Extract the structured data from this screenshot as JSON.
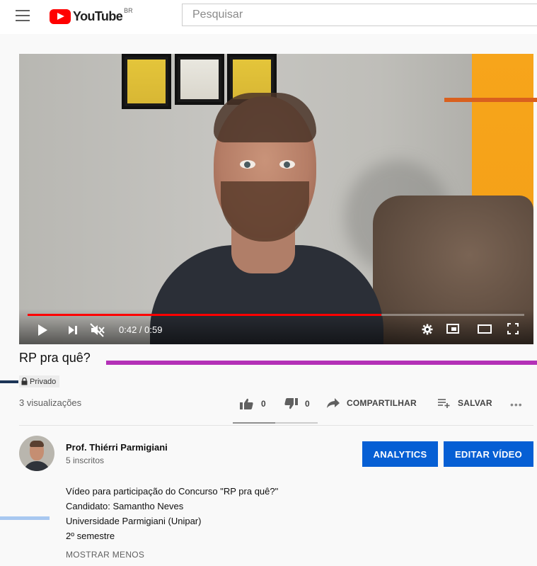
{
  "header": {
    "logo_text": "YouTube",
    "logo_country": "BR",
    "search_placeholder": "Pesquisar"
  },
  "player": {
    "time": "0:42 / 0:59",
    "progress_fraction": 0.712
  },
  "video": {
    "title": "RP pra quê?",
    "privacy": "Privado",
    "views": "3 visualizações"
  },
  "actions": {
    "likes": "0",
    "dislikes": "0",
    "share": "COMPARTILHAR",
    "save": "SALVAR",
    "more": "•••"
  },
  "channel": {
    "name": "Prof. Thiérri Parmigiani",
    "subscribers": "5 inscritos",
    "analytics_label": "ANALYTICS",
    "edit_label": "EDITAR VÍDEO"
  },
  "description": {
    "lines": [
      "Vídeo para participação do Concurso \"RP pra quê?\"",
      "Candidato: Samantho Neves",
      "Universidade Parmigiani (Unipar)",
      "2º semestre"
    ],
    "show_less": "MOSTRAR MENOS"
  },
  "colors": {
    "accent_red": "#ff0000",
    "button_blue": "#065fd4",
    "overlay_orange": "#d9601e",
    "overlay_magenta": "#b431b7",
    "overlay_navy": "#1d3557",
    "overlay_lightblue": "#a8c8f0"
  }
}
